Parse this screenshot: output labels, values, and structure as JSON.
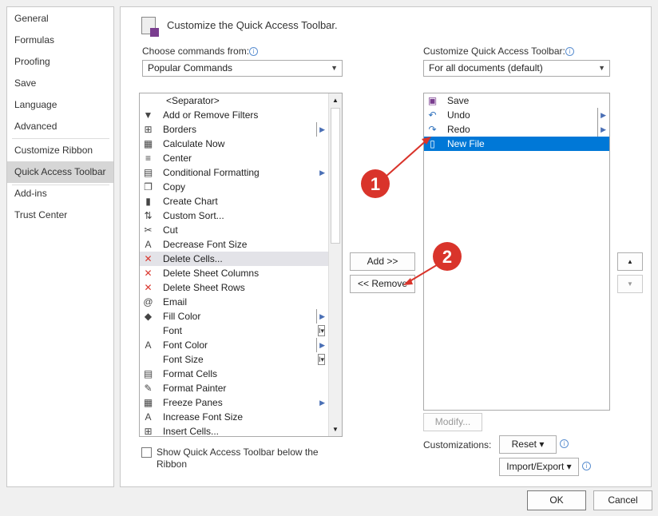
{
  "sidebar": {
    "items": [
      "General",
      "Formulas",
      "Proofing",
      "Save",
      "Language",
      "Advanced",
      "Customize Ribbon",
      "Quick Access Toolbar",
      "Add-ins",
      "Trust Center"
    ],
    "selected": "Quick Access Toolbar"
  },
  "header": {
    "title": "Customize the Quick Access Toolbar."
  },
  "left": {
    "label": "Choose commands from:",
    "dropdown": "Popular Commands",
    "commands": [
      {
        "label": "<Separator>",
        "icon": ""
      },
      {
        "label": "Add or Remove Filters",
        "icon": "filter-icon"
      },
      {
        "label": "Borders",
        "icon": "borders-icon",
        "sub": "split"
      },
      {
        "label": "Calculate Now",
        "icon": "calculator-icon"
      },
      {
        "label": "Center",
        "icon": "align-center-icon"
      },
      {
        "label": "Conditional Formatting",
        "icon": "conditional-formatting-icon",
        "sub": "arrow"
      },
      {
        "label": "Copy",
        "icon": "copy-icon"
      },
      {
        "label": "Create Chart",
        "icon": "chart-icon"
      },
      {
        "label": "Custom Sort...",
        "icon": "sort-icon"
      },
      {
        "label": "Cut",
        "icon": "scissors-icon"
      },
      {
        "label": "Decrease Font Size",
        "icon": "decrease-font-icon"
      },
      {
        "label": "Delete Cells...",
        "icon": "delete-cells-icon",
        "selected": true
      },
      {
        "label": "Delete Sheet Columns",
        "icon": "delete-columns-icon"
      },
      {
        "label": "Delete Sheet Rows",
        "icon": "delete-rows-icon"
      },
      {
        "label": "Email",
        "icon": "email-icon"
      },
      {
        "label": "Fill Color",
        "icon": "fill-color-icon",
        "sub": "split"
      },
      {
        "label": "Font",
        "icon": "",
        "sub": "combo"
      },
      {
        "label": "Font Color",
        "icon": "font-color-icon",
        "sub": "split"
      },
      {
        "label": "Font Size",
        "icon": "",
        "sub": "combo"
      },
      {
        "label": "Format Cells",
        "icon": "format-cells-icon"
      },
      {
        "label": "Format Painter",
        "icon": "format-painter-icon"
      },
      {
        "label": "Freeze Panes",
        "icon": "freeze-panes-icon",
        "sub": "arrow"
      },
      {
        "label": "Increase Font Size",
        "icon": "increase-font-icon"
      },
      {
        "label": "Insert Cells...",
        "icon": "insert-cells-icon"
      }
    ],
    "checkbox": "Show Quick Access Toolbar below the Ribbon"
  },
  "middle": {
    "add": "Add >>",
    "remove": "<< Remove"
  },
  "right": {
    "label": "Customize Quick Access Toolbar:",
    "dropdown": "For all documents (default)",
    "items": [
      {
        "label": "Save",
        "icon": "save-icon"
      },
      {
        "label": "Undo",
        "icon": "undo-icon",
        "sub": "split"
      },
      {
        "label": "Redo",
        "icon": "redo-icon",
        "sub": "split"
      },
      {
        "label": "New File",
        "icon": "new-file-icon",
        "selected": true
      }
    ],
    "modify": "Modify...",
    "customizations": "Customizations:",
    "reset": "Reset ▾",
    "import_export": "Import/Export ▾"
  },
  "annotations": [
    "1",
    "2"
  ],
  "footer": {
    "ok": "OK",
    "cancel": "Cancel"
  },
  "colors": {
    "selection": "#0078d7",
    "annotation": "#d9342b"
  }
}
